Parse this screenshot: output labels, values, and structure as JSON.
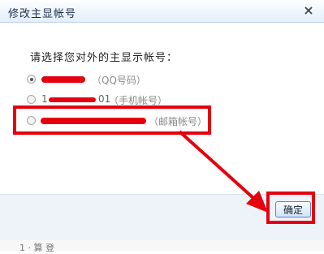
{
  "dialog": {
    "title": "修改主显帐号",
    "close_label": "×"
  },
  "prompt": "请选择您对外的主显示帐号：",
  "options": [
    {
      "label_visible": "",
      "type_label": "（QQ号码）",
      "checked": true
    },
    {
      "label_visible": "1",
      "label_suffix": "01",
      "type_label": "（手机帐号）",
      "checked": false
    },
    {
      "label_visible": "",
      "type_label": "（邮箱帐号）",
      "checked": false
    }
  ],
  "footer": {
    "ok_label": "确定",
    "bottom_text": "1 · 算  登"
  },
  "colors": {
    "highlight": "#e4000f",
    "title_gradient_top": "#fdfeff",
    "title_gradient_bottom": "#e3eefa",
    "footer_bg": "#eef3f9"
  }
}
